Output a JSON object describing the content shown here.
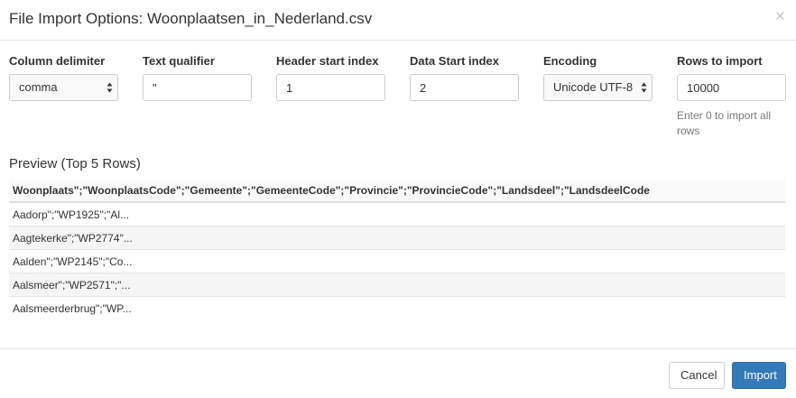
{
  "dialog": {
    "title": "File Import Options: Woonplaatsen_in_Nederland.csv",
    "close_glyph": "×"
  },
  "fields": {
    "column_delimiter": {
      "label": "Column delimiter",
      "value": "comma"
    },
    "text_qualifier": {
      "label": "Text qualifier",
      "value": "\""
    },
    "header_start_index": {
      "label": "Header start index",
      "value": "1"
    },
    "data_start_index": {
      "label": "Data Start index",
      "value": "2"
    },
    "encoding": {
      "label": "Encoding",
      "value": "Unicode UTF-8"
    },
    "rows_to_import": {
      "label": "Rows to import",
      "value": "10000",
      "help": "Enter 0 to import all rows"
    }
  },
  "preview": {
    "title": "Preview (Top 5 Rows)",
    "header": "Woonplaats\";\"WoonplaatsCode\";\"Gemeente\";\"GemeenteCode\";\"Provincie\";\"ProvincieCode\";\"Landsdeel\";\"LandsdeelCode",
    "rows": [
      "Aadorp\";\"WP1925\";\"Al...",
      "Aagtekerke\";\"WP2774\"...",
      "Aalden\";\"WP2145\";\"Co...",
      "Aalsmeer\";\"WP2571\";\"...",
      "Aalsmeerderbrug\";\"WP..."
    ]
  },
  "footer": {
    "cancel_label": "Cancel",
    "import_label": "Import"
  },
  "colors": {
    "primary": "#337ab7",
    "border": "#cccccc",
    "muted_text": "#777777"
  }
}
